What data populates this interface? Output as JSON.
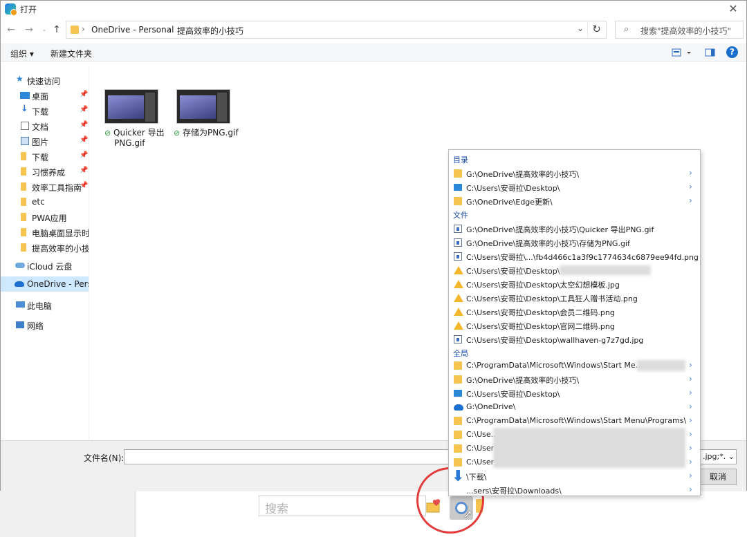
{
  "window": {
    "title": "打开"
  },
  "address": {
    "crumbs": [
      "OneDrive - Personal",
      "提高效率的小技巧"
    ],
    "search_placeholder": "搜索\"提高效率的小技巧\""
  },
  "toolbar": {
    "organize": "组织 ▾",
    "new_folder": "新建文件夹"
  },
  "sidebar": {
    "items": [
      {
        "label": "快速访问"
      },
      {
        "label": "桌面"
      },
      {
        "label": "下载"
      },
      {
        "label": "文档"
      },
      {
        "label": "图片"
      },
      {
        "label": "下载"
      },
      {
        "label": "习惯养成"
      },
      {
        "label": "效率工具指南"
      },
      {
        "label": "etc"
      },
      {
        "label": "PWA应用"
      },
      {
        "label": "电脑桌面显示时间"
      },
      {
        "label": "提高效率的小技巧"
      },
      {
        "label": "iCloud 云盘"
      },
      {
        "label": "OneDrive - Personal"
      },
      {
        "label": "此电脑"
      },
      {
        "label": "网络"
      }
    ]
  },
  "files": [
    {
      "name_line1": "Quicker 导出",
      "name_line2": "PNG.gif"
    },
    {
      "name_line1": "存储为PNG.gif",
      "name_line2": ""
    }
  ],
  "bottom": {
    "filename_label": "文件名(N):",
    "filetype": ".jpg;*.",
    "cancel": "取消"
  },
  "outer": {
    "search_placeholder": "搜索"
  },
  "popup": {
    "sections": {
      "dirs": "目录",
      "files": "文件",
      "global": "全局"
    },
    "dirs": [
      {
        "path": "G:\\OneDrive\\提高效率的小技巧\\",
        "icon": "folder"
      },
      {
        "path": "C:\\Users\\安哥拉\\Desktop\\",
        "icon": "desktop"
      },
      {
        "path": "G:\\OneDrive\\Edge更新\\",
        "icon": "folder"
      }
    ],
    "files": [
      {
        "path": "G:\\OneDrive\\提高效率的小技巧\\Quicker 导出PNG.gif",
        "icon": "file"
      },
      {
        "path": "G:\\OneDrive\\提高效率的小技巧\\存储为PNG.gif",
        "icon": "file"
      },
      {
        "path": "C:\\Users\\安哥拉\\...\\fb4d466c1a3f9c1774634c6879ee94fd.png",
        "icon": "file"
      },
      {
        "path": "C:\\Users\\安哥拉\\Desktop\\",
        "icon": "warn"
      },
      {
        "path": "C:\\Users\\安哥拉\\Desktop\\太空幻想模板.jpg",
        "icon": "warn"
      },
      {
        "path": "C:\\Users\\安哥拉\\Desktop\\工具狂人赠书活动.png",
        "icon": "warn"
      },
      {
        "path": "C:\\Users\\安哥拉\\Desktop\\会员二维码.png",
        "icon": "warn"
      },
      {
        "path": "C:\\Users\\安哥拉\\Desktop\\官网二维码.png",
        "icon": "warn"
      },
      {
        "path": "C:\\Users\\安哥拉\\Desktop\\wallhaven-g7z7gd.jpg",
        "icon": "file"
      }
    ],
    "global": [
      {
        "path": "C:\\ProgramData\\Microsoft\\Windows\\Start Me...",
        "icon": "folder"
      },
      {
        "path": "G:\\OneDrive\\提高效率的小技巧\\",
        "icon": "folder"
      },
      {
        "path": "C:\\Users\\安哥拉\\Desktop\\",
        "icon": "desktop"
      },
      {
        "path": "G:\\OneDrive\\",
        "icon": "cloud"
      },
      {
        "path": "C:\\ProgramData\\Microsoft\\Windows\\Start Menu\\Programs\\",
        "icon": "folder"
      },
      {
        "path": "C:\\Use...",
        "icon": "folder"
      },
      {
        "path": "C:\\User",
        "icon": "folder"
      },
      {
        "path": "C:\\User",
        "icon": "folder"
      },
      {
        "path": "\\下载\\",
        "icon": "download"
      },
      {
        "path": "...sers\\安哥拉\\Downloads\\",
        "icon": "download"
      }
    ]
  }
}
